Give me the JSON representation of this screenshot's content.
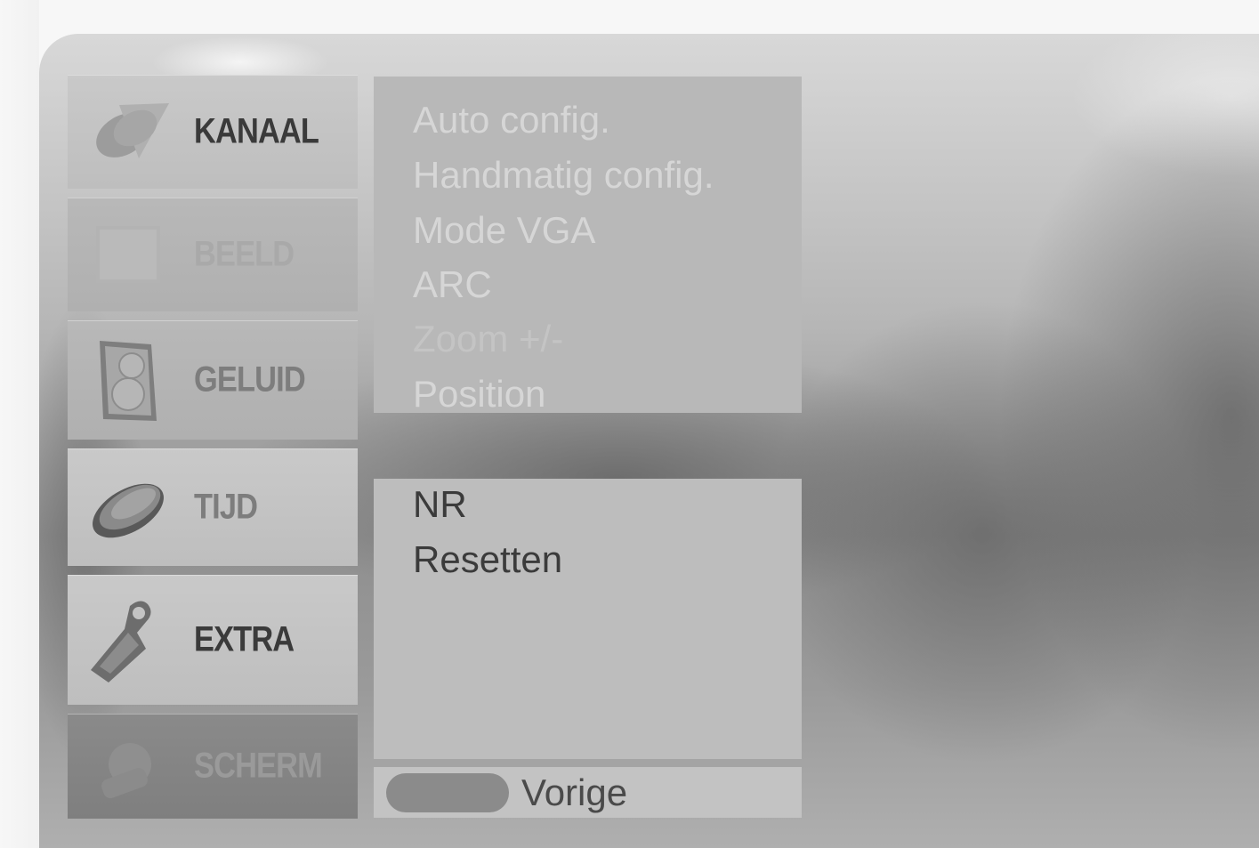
{
  "categories": [
    {
      "label": "KANAAL",
      "icon": "satellite-dish-icon"
    },
    {
      "label": "BEELD",
      "icon": "picture-screen-icon"
    },
    {
      "label": "GELUID",
      "icon": "speaker-icon"
    },
    {
      "label": "TIJD",
      "icon": "clock-icon"
    },
    {
      "label": "EXTRA",
      "icon": "tag-icon"
    },
    {
      "label": "SCHERM",
      "icon": "screen-settings-icon"
    }
  ],
  "submenu": {
    "items": [
      "Auto config.",
      "Handmatig config.",
      "Mode VGA",
      "ARC",
      "Zoom +/-",
      "Position"
    ],
    "items_lower": [
      "NR",
      "Resetten"
    ]
  },
  "footer": {
    "back_label": "Vorige"
  },
  "colors": {
    "active_category": "#7f7f7f",
    "panel": "#b9b9b9",
    "text_dark": "#3b3b3b"
  }
}
